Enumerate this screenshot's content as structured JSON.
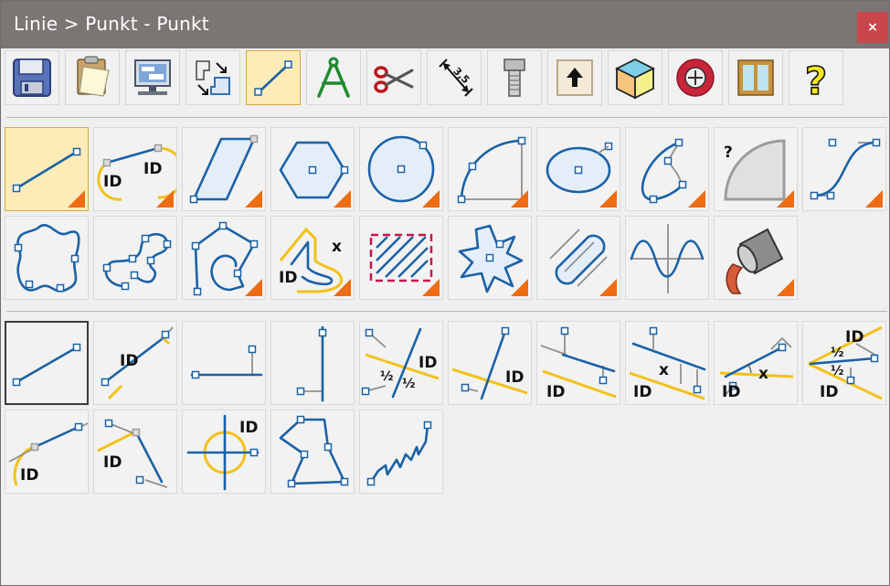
{
  "window": {
    "title": "Linie > Punkt - Punkt",
    "close_label": "×"
  },
  "toolbar": {
    "items": [
      {
        "name": "save-icon"
      },
      {
        "name": "clipboard-icon"
      },
      {
        "name": "computer-icon"
      },
      {
        "name": "arrange-icon"
      },
      {
        "name": "line-icon",
        "active": true
      },
      {
        "name": "compass-icon"
      },
      {
        "name": "scissors-icon"
      },
      {
        "name": "dimension-icon",
        "label": "3,5"
      },
      {
        "name": "screw-icon"
      },
      {
        "name": "upload-icon"
      },
      {
        "name": "cube-icon"
      },
      {
        "name": "saw-icon"
      },
      {
        "name": "window-icon"
      },
      {
        "name": "help-icon",
        "label": "?"
      }
    ]
  },
  "shapes": {
    "labels": {
      "id": "ID",
      "x": "x",
      "half": "½",
      "question": "?"
    },
    "row1": [
      "line-point-point",
      "line-arc-id",
      "parallelogram",
      "hexagon",
      "circle",
      "arc",
      "ellipse",
      "spline-curve",
      "unknown-shape",
      "s-curve"
    ],
    "row2": [
      "wavy-closed-curve",
      "snake-curve",
      "polygon-curve",
      "offset-contour",
      "hatched-rectangle",
      "star",
      "slot",
      "sine-wave",
      "paint-bucket"
    ]
  },
  "lines": {
    "row1": [
      "line-point-point",
      "line-id-angle",
      "horizontal-line",
      "vertical-line",
      "bisector-line",
      "line-angle-id",
      "parallel-line",
      "parallel-distance",
      "angle-distance",
      "angle-bisector"
    ],
    "row2": [
      "tangent-line",
      "perpendicular-line",
      "crosshair-circle",
      "polyline",
      "zigzag-line"
    ]
  },
  "colors": {
    "accent": "#1b62a6",
    "highlight": "#fdecb8",
    "secondary": "#f3c11a",
    "corner": "#ee6c13",
    "title_bar": "#7b7674",
    "close": "#c9474c"
  }
}
